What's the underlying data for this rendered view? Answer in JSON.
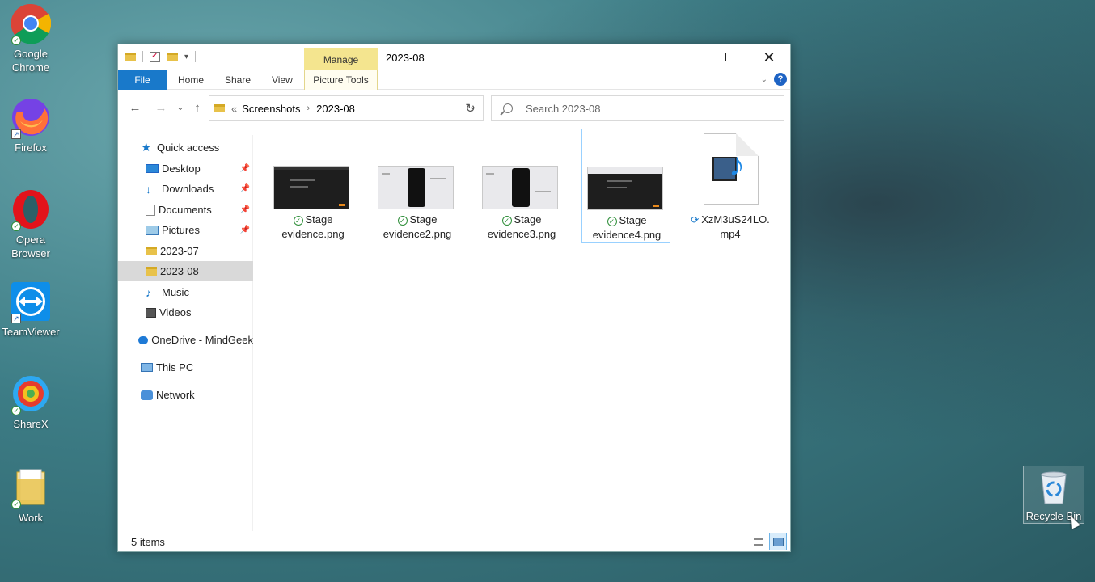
{
  "desktop": {
    "icons": [
      {
        "label": "Google Chrome",
        "icon": "chrome-icon"
      },
      {
        "label": "Firefox",
        "icon": "firefox-icon"
      },
      {
        "label": "Opera Browser",
        "icon": "opera-icon"
      },
      {
        "label": "TeamViewer",
        "icon": "teamviewer-icon"
      },
      {
        "label": "ShareX",
        "icon": "sharex-icon"
      },
      {
        "label": "Work",
        "icon": "folder-icon"
      }
    ],
    "recycle_bin": "Recycle Bin"
  },
  "window": {
    "title": "2023-08",
    "manage_tab": "Manage",
    "ribbon": {
      "file": "File",
      "home": "Home",
      "share": "Share",
      "view": "View",
      "picture_tools": "Picture Tools"
    },
    "address": {
      "prefix": "«",
      "crumbs": [
        "Screenshots",
        "2023-08"
      ]
    },
    "search": {
      "placeholder": "Search 2023-08"
    },
    "sidebar": {
      "items": [
        {
          "label": "Quick access",
          "icon": "star-icon"
        },
        {
          "label": "Desktop",
          "icon": "desktop-icon",
          "pinned": true
        },
        {
          "label": "Downloads",
          "icon": "download-icon",
          "pinned": true
        },
        {
          "label": "Documents",
          "icon": "documents-icon",
          "pinned": true
        },
        {
          "label": "Pictures",
          "icon": "pictures-icon",
          "pinned": true
        },
        {
          "label": "2023-07",
          "icon": "folder-icon"
        },
        {
          "label": "2023-08",
          "icon": "folder-icon",
          "selected": true
        },
        {
          "label": "Music",
          "icon": "music-icon"
        },
        {
          "label": "Videos",
          "icon": "videos-icon"
        },
        {
          "label": "OneDrive - MindGeek",
          "icon": "onedrive-icon"
        },
        {
          "label": "This PC",
          "icon": "pc-icon"
        },
        {
          "label": "Network",
          "icon": "network-icon"
        }
      ]
    },
    "files": [
      {
        "line1": "Stage",
        "line2": "evidence.png",
        "status": "synced"
      },
      {
        "line1": "Stage",
        "line2": "evidence2.png",
        "status": "synced"
      },
      {
        "line1": "Stage",
        "line2": "evidence3.png",
        "status": "synced"
      },
      {
        "line1": "Stage",
        "line2": "evidence4.png",
        "status": "synced",
        "selected": true
      },
      {
        "line1": "XzM3uS24LO.",
        "line2": "mp4",
        "status": "syncing"
      }
    ],
    "status": {
      "items": "5 items"
    }
  },
  "colors": {
    "accent": "#1979ca",
    "manage": "#f4e58f",
    "selected": "#d9d9d9"
  }
}
